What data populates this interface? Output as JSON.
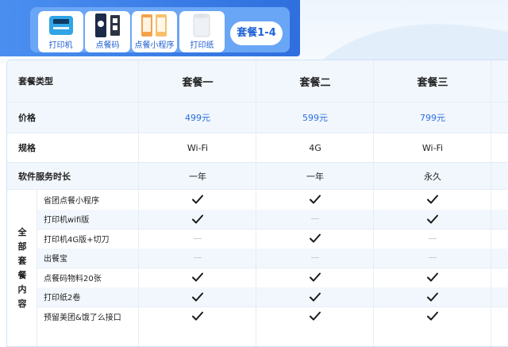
{
  "banner": {
    "products": [
      {
        "label": "打印机",
        "icon": "printer-icon"
      },
      {
        "label": "点餐码",
        "icon": "qr-stand-icon"
      },
      {
        "label": "点餐小程序",
        "icon": "mini-program-icon"
      },
      {
        "label": "打印纸",
        "icon": "paper-roll-icon"
      }
    ],
    "package_tag": "套餐1-4"
  },
  "table": {
    "header": {
      "label": "套餐类型",
      "plans": [
        "套餐一",
        "套餐二",
        "套餐三"
      ]
    },
    "price": {
      "label": "价格",
      "values": [
        "499元",
        "599元",
        "799元"
      ]
    },
    "spec": {
      "label": "规格",
      "values": [
        "Wi-Fi",
        "4G",
        "Wi-Fi"
      ]
    },
    "duration": {
      "label": "软件服务时长",
      "values": [
        "一年",
        "一年",
        "永久"
      ]
    },
    "contents_label": [
      "全",
      "部",
      "套",
      "餐",
      "内",
      "容"
    ],
    "items": [
      {
        "name": "省团点餐小程序",
        "marks": [
          true,
          true,
          true
        ]
      },
      {
        "name": "打印机wifi版",
        "marks": [
          true,
          false,
          true
        ]
      },
      {
        "name": "打印机4G版+切刀",
        "marks": [
          false,
          true,
          false
        ]
      },
      {
        "name": "出餐宝",
        "marks": [
          false,
          false,
          false
        ]
      },
      {
        "name": "点餐码物料20张",
        "marks": [
          true,
          true,
          true
        ]
      },
      {
        "name": "打印纸2卷",
        "marks": [
          true,
          true,
          true
        ]
      },
      {
        "name": "预留美团&饿了么接口",
        "marks": [
          true,
          true,
          true
        ]
      }
    ]
  },
  "colors": {
    "accent": "#2a6fe0",
    "banner": "#3b7fe8",
    "row_shade": "#f2f7fd"
  }
}
